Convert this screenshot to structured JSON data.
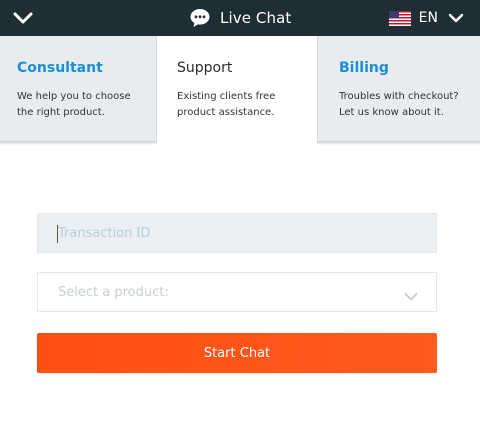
{
  "header": {
    "title": "Live Chat",
    "language": "EN"
  },
  "tabs": [
    {
      "title": "Consultant",
      "description": "We help you to choose the right product.",
      "active": false
    },
    {
      "title": "Support",
      "description": "Existing clients free product assistance.",
      "active": true
    },
    {
      "title": "Billing",
      "description": "Troubles with checkout? Let us know about it.",
      "active": false
    }
  ],
  "form": {
    "transaction_placeholder": "Transaction ID",
    "transaction_value": "",
    "product_placeholder": "Select a product:",
    "start_label": "Start Chat"
  },
  "colors": {
    "header_bg": "#1f2d35",
    "tab_title": "#1a8fd6",
    "inactive_tab_bg": "#e8ecef",
    "button_accent": "#ff5019"
  }
}
